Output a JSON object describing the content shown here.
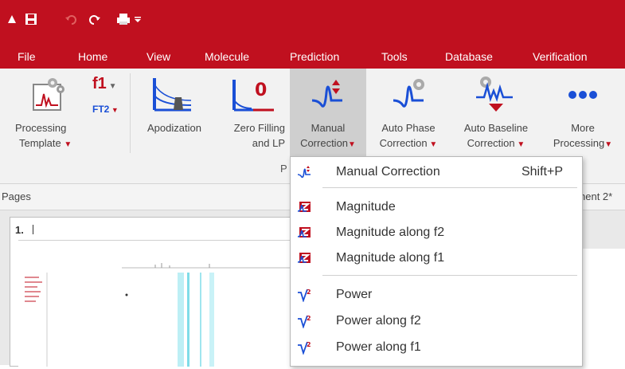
{
  "menubar": {
    "items": [
      "File",
      "Home",
      "View",
      "Molecule",
      "Prediction",
      "Tools",
      "Database",
      "Verification"
    ]
  },
  "ribbon": {
    "processing_template": "Processing\nTemplate",
    "f1_label": "f1",
    "ft2_label": "FT2",
    "apodization": "Apodization",
    "zero_filling_line1": "Zero Filling",
    "zero_filling_line2": "and LP",
    "manual_correction_line1": "Manual",
    "manual_correction_line2": "Correction",
    "auto_phase_line1": "Auto Phase",
    "auto_phase_line2": "Correction",
    "auto_baseline_line1": "Auto Baseline",
    "auto_baseline_line2": "Correction",
    "more_processing_line1": "More",
    "more_processing_line2": "Processing",
    "group_label": "P"
  },
  "pages": {
    "label": "Pages",
    "doc_tab": "hent 2*",
    "page_number": "1."
  },
  "dropdown": {
    "items": [
      {
        "label": "Manual Correction",
        "shortcut": "Shift+P",
        "icon": "manual-correction-icon"
      },
      {
        "label": "Magnitude",
        "icon": "magnitude-icon"
      },
      {
        "label": "Magnitude along f2",
        "icon": "magnitude-icon"
      },
      {
        "label": "Magnitude along f1",
        "icon": "magnitude-icon"
      },
      {
        "label": "Power",
        "icon": "power-icon"
      },
      {
        "label": "Power along f2",
        "icon": "power-icon"
      },
      {
        "label": "Power along f1",
        "icon": "power-icon"
      }
    ]
  },
  "colors": {
    "brand_red": "#c0101f",
    "spectrum_blue": "#1a4fd6",
    "ribbon_bg": "#f2f2f2"
  }
}
